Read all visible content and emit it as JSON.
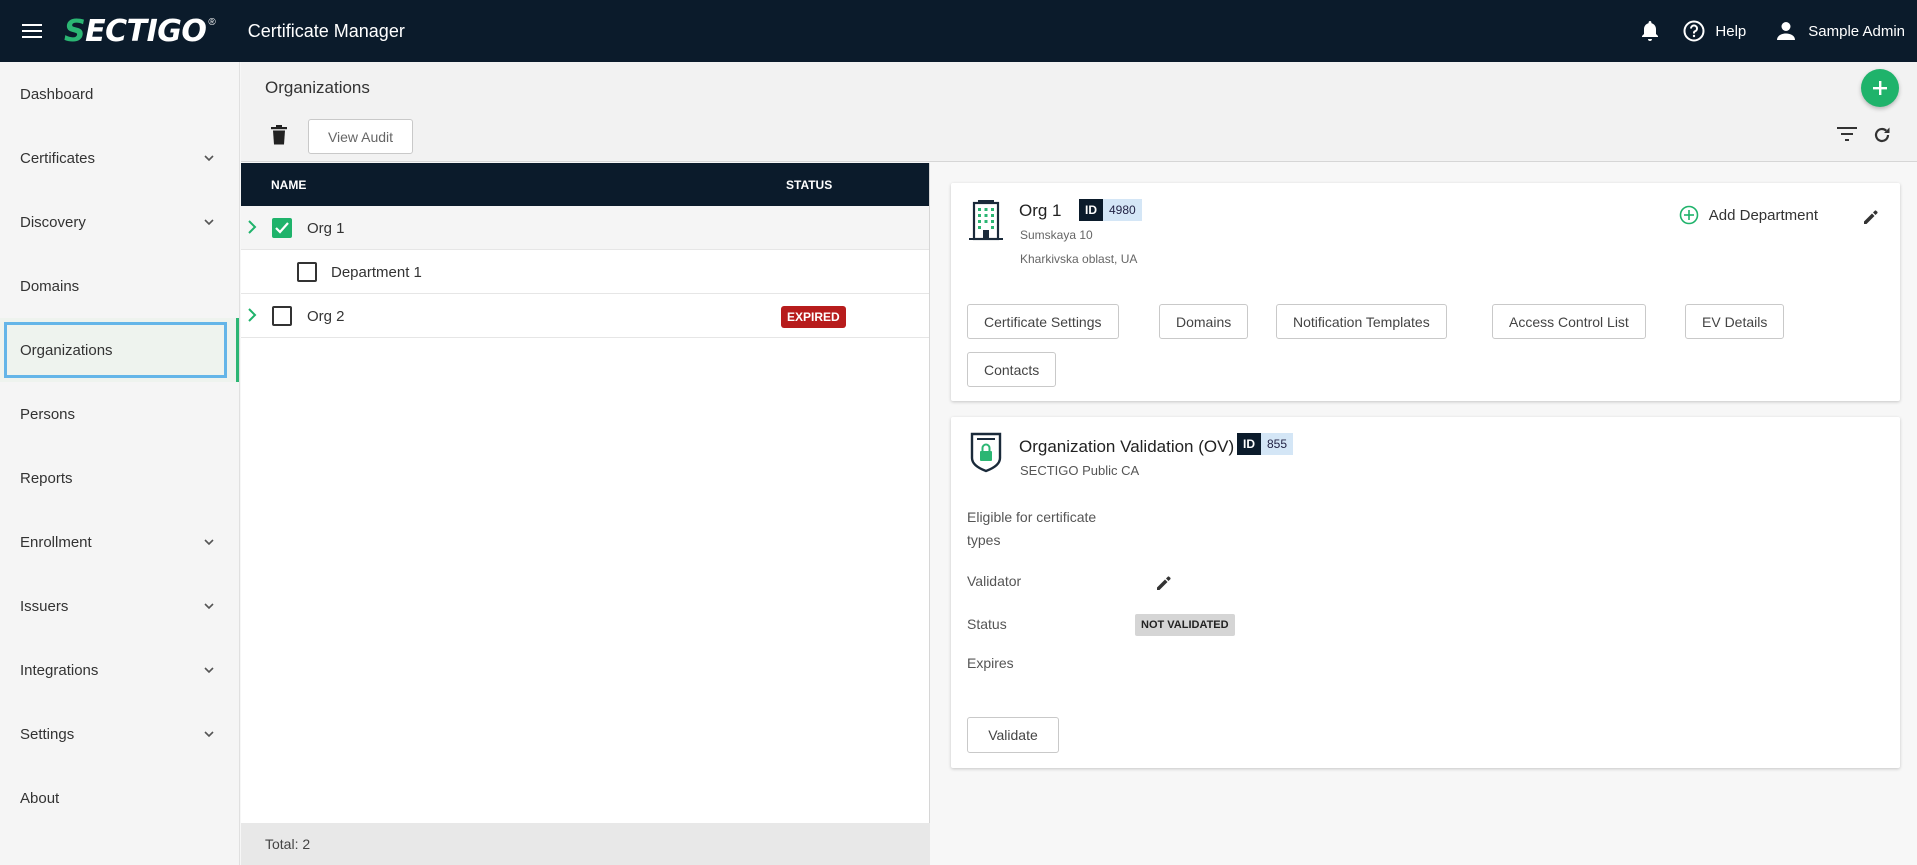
{
  "header": {
    "logo_text_s": "S",
    "logo_text_rest": "ECTIGO",
    "logo_reg": "®",
    "app_title": "Certificate Manager",
    "help_label": "Help",
    "user_label": "Sample Admin"
  },
  "sidebar": {
    "items": [
      {
        "label": "Dashboard",
        "expandable": false
      },
      {
        "label": "Certificates",
        "expandable": true
      },
      {
        "label": "Discovery",
        "expandable": true
      },
      {
        "label": "Domains",
        "expandable": false
      },
      {
        "label": "Organizations",
        "expandable": false,
        "active": true
      },
      {
        "label": "Persons",
        "expandable": false
      },
      {
        "label": "Reports",
        "expandable": false
      },
      {
        "label": "Enrollment",
        "expandable": true
      },
      {
        "label": "Issuers",
        "expandable": true
      },
      {
        "label": "Integrations",
        "expandable": true
      },
      {
        "label": "Settings",
        "expandable": true
      },
      {
        "label": "About",
        "expandable": false
      }
    ]
  },
  "page": {
    "title": "Organizations",
    "view_audit_label": "View Audit"
  },
  "table": {
    "columns": [
      "NAME",
      "STATUS"
    ],
    "rows": [
      {
        "name": "Org 1",
        "checked": true,
        "status": ""
      },
      {
        "name": "Department 1",
        "checked": false,
        "status": ""
      },
      {
        "name": "Org 2",
        "checked": false,
        "status": "EXPIRED"
      }
    ],
    "footer": "Total: 2"
  },
  "org_card": {
    "name": "Org 1",
    "id_key": "ID",
    "id_value": "4980",
    "address_line1": "Sumskaya 10",
    "address_line2": "Kharkivska oblast, UA",
    "add_department_label": "Add Department",
    "buttons": [
      "Certificate Settings",
      "Domains",
      "Notification Templates",
      "Access Control List",
      "EV Details",
      "Contacts"
    ]
  },
  "ov_card": {
    "title": "Organization Validation (OV)",
    "id_key": "ID",
    "id_value": "855",
    "subtitle": "SECTIGO Public CA",
    "eligible_label": "Eligible for certificate types",
    "validator_label": "Validator",
    "status_label": "Status",
    "status_value": "NOT VALIDATED",
    "expires_label": "Expires",
    "validate_label": "Validate"
  },
  "colors": {
    "topbar": "#0b1b2b",
    "accent_green": "#1fb36b",
    "expired_red": "#b71c1c",
    "active_outline": "#64b5e8"
  }
}
